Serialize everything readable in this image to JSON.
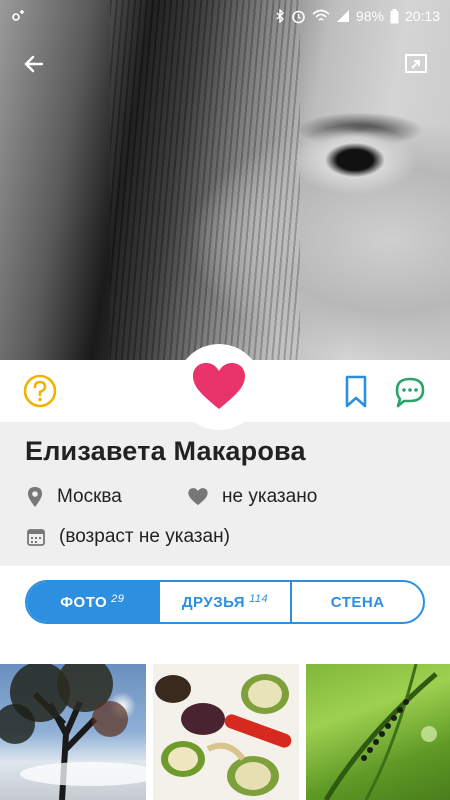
{
  "status_bar": {
    "battery": "98%",
    "time": "20:13"
  },
  "profile": {
    "name": "Елизавета Макарова",
    "city": "Москва",
    "relationship": "не указано",
    "age": "(возраст не указан)"
  },
  "tabs": [
    {
      "label": "ФОТО",
      "count": "29",
      "active": true
    },
    {
      "label": "ДРУЗЬЯ",
      "count": "114",
      "active": false
    },
    {
      "label": "СТЕНА",
      "count": "",
      "active": false
    }
  ],
  "icons": {
    "back": "arrow-left-icon",
    "share": "open-external-icon",
    "help": "question-circle-icon",
    "like": "heart-icon",
    "bookmark": "bookmark-icon",
    "message": "chat-bubble-icon",
    "city": "location-pin-icon",
    "relationship": "heart-small-icon",
    "age": "calendar-icon"
  },
  "colors": {
    "accent": "#2d8fe0",
    "like": "#e8336b",
    "help": "#f0b400",
    "message": "#2aa36b"
  }
}
